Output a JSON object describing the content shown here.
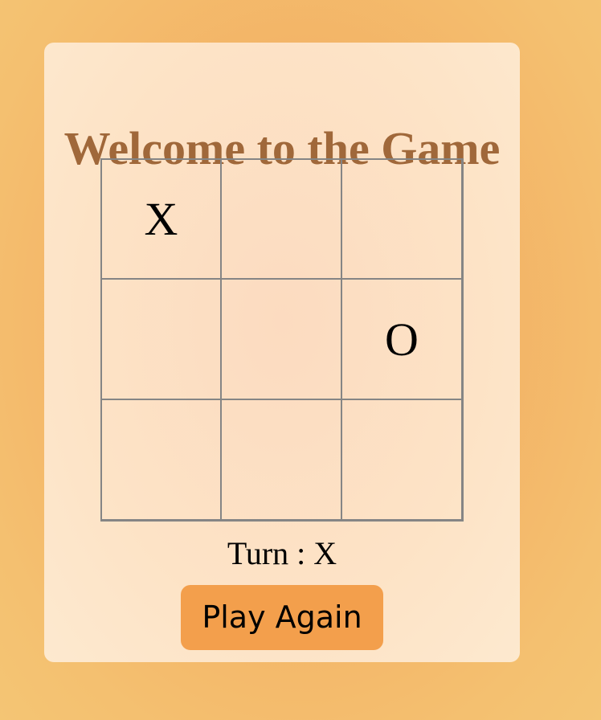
{
  "game": {
    "title": "Welcome to the Game",
    "board": [
      "X",
      "",
      "",
      "",
      "",
      "O",
      "",
      "",
      ""
    ],
    "turn_label": "Turn",
    "turn_separator": ":",
    "current_turn": "X",
    "play_again_label": "Play Again"
  },
  "colors": {
    "title": "#a0683a",
    "button": "#f39f4c",
    "grid_line": "#858585",
    "card": "#fde3c6",
    "background": "#f3b366"
  }
}
